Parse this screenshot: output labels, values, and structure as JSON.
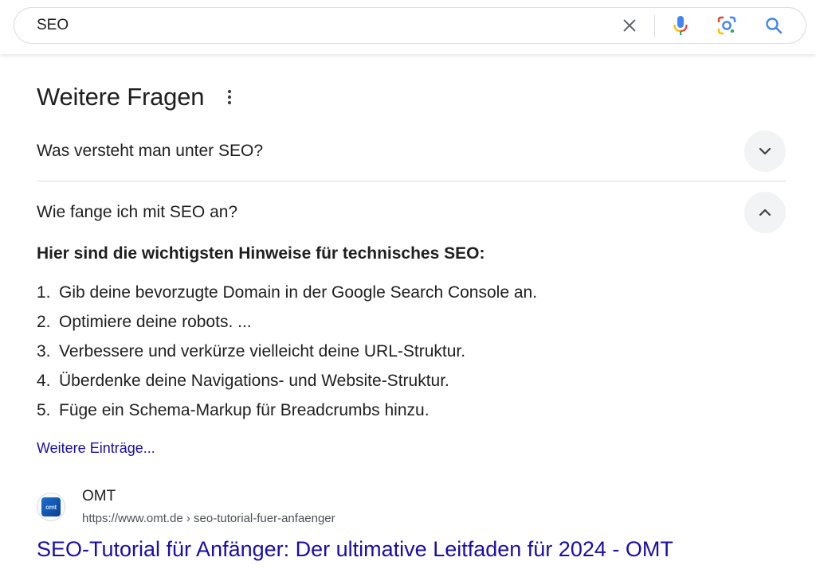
{
  "search": {
    "query": "SEO",
    "clear_icon": "close-icon",
    "voice_icon": "microphone-icon",
    "lens_icon": "camera-lens-icon",
    "search_icon": "search-icon"
  },
  "people_also_ask": {
    "title": "Weitere Fragen",
    "menu_icon": "more-vertical-icon",
    "questions": [
      {
        "text": "Was versteht man unter SEO?",
        "expanded": false,
        "icon": "chevron-down-icon"
      },
      {
        "text": "Wie fange ich mit SEO an?",
        "expanded": true,
        "icon": "chevron-up-icon"
      }
    ],
    "answer": {
      "heading": "Hier sind die wichtigsten Hinweise für technisches SEO:",
      "items": [
        {
          "num": "1.",
          "text": "Gib deine bevorzugte Domain in der Google Search Console an."
        },
        {
          "num": "2.",
          "text": "Optimiere deine robots. ..."
        },
        {
          "num": "3.",
          "text": "Verbessere und verkürze vielleicht deine URL-Struktur."
        },
        {
          "num": "4.",
          "text": "Überdenke deine Navigations- und Website-Struktur."
        },
        {
          "num": "5.",
          "text": "Füge ein Schema-Markup für Breadcrumbs hinzu."
        }
      ],
      "more_link": "Weitere Einträge..."
    }
  },
  "result": {
    "favicon_label": "omt",
    "site_name": "OMT",
    "url": "https://www.omt.de › seo-tutorial-fuer-anfaenger",
    "title": "SEO-Tutorial für Anfänger: Der ultimative Leitfaden für 2024 - OMT"
  },
  "colors": {
    "link": "#1a0dab",
    "text": "#1f1f1f",
    "muted": "#4d5156",
    "google_blue": "#4285f4",
    "google_red": "#ea4335",
    "google_yellow": "#fbbc04",
    "google_green": "#34a853"
  }
}
